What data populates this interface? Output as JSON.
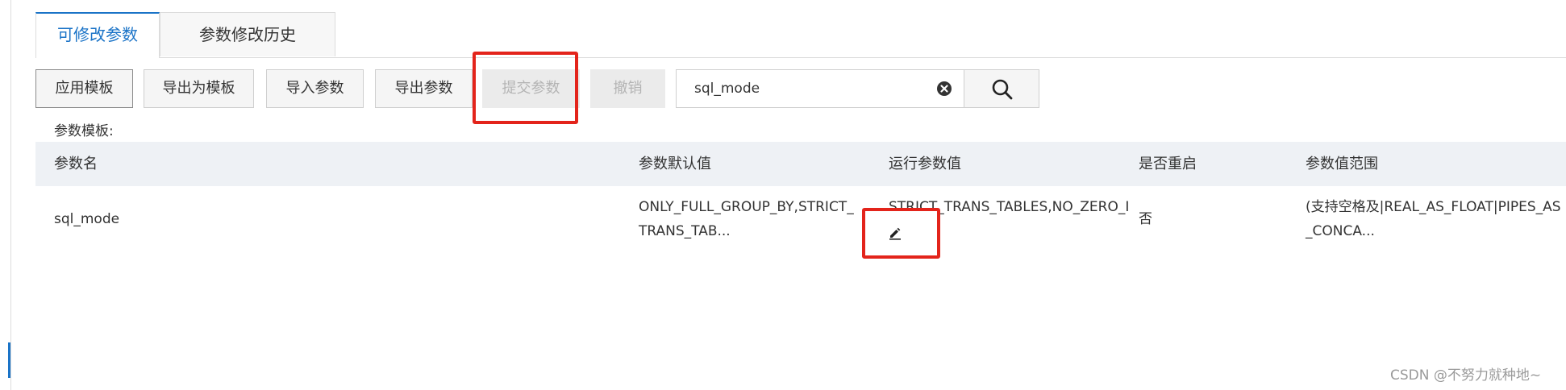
{
  "tabs": [
    {
      "label": "可修改参数"
    },
    {
      "label": "参数修改历史"
    }
  ],
  "toolbar": {
    "apply_template": "应用模板",
    "export_as_template": "导出为模板",
    "import_params": "导入参数",
    "export_params": "导出参数",
    "submit_params": "提交参数",
    "cancel": "撤销"
  },
  "search": {
    "value": "sql_mode",
    "clear_icon": "clear-circle-icon",
    "search_icon": "magnifier-icon"
  },
  "template_label": "参数模板:",
  "table": {
    "headers": {
      "name": "参数名",
      "default_value": "参数默认值",
      "running_value": "运行参数值",
      "restart": "是否重启",
      "range": "参数值范围"
    },
    "rows": [
      {
        "name": "sql_mode",
        "default_value": "ONLY_FULL_GROUP_BY,STRICT_TRANS_TAB...",
        "running_value": "STRICT_TRANS_TABLES,NO_ZERO_I...",
        "restart": "否",
        "range": "(支持空格及|REAL_AS_FLOAT|PIPES_AS_CONCA..."
      }
    ]
  },
  "watermark": "CSDN @不努力就种地~",
  "colors": {
    "accent": "#1a73c7",
    "annotation": "#e3241b",
    "header_bg": "#eef1f5"
  }
}
